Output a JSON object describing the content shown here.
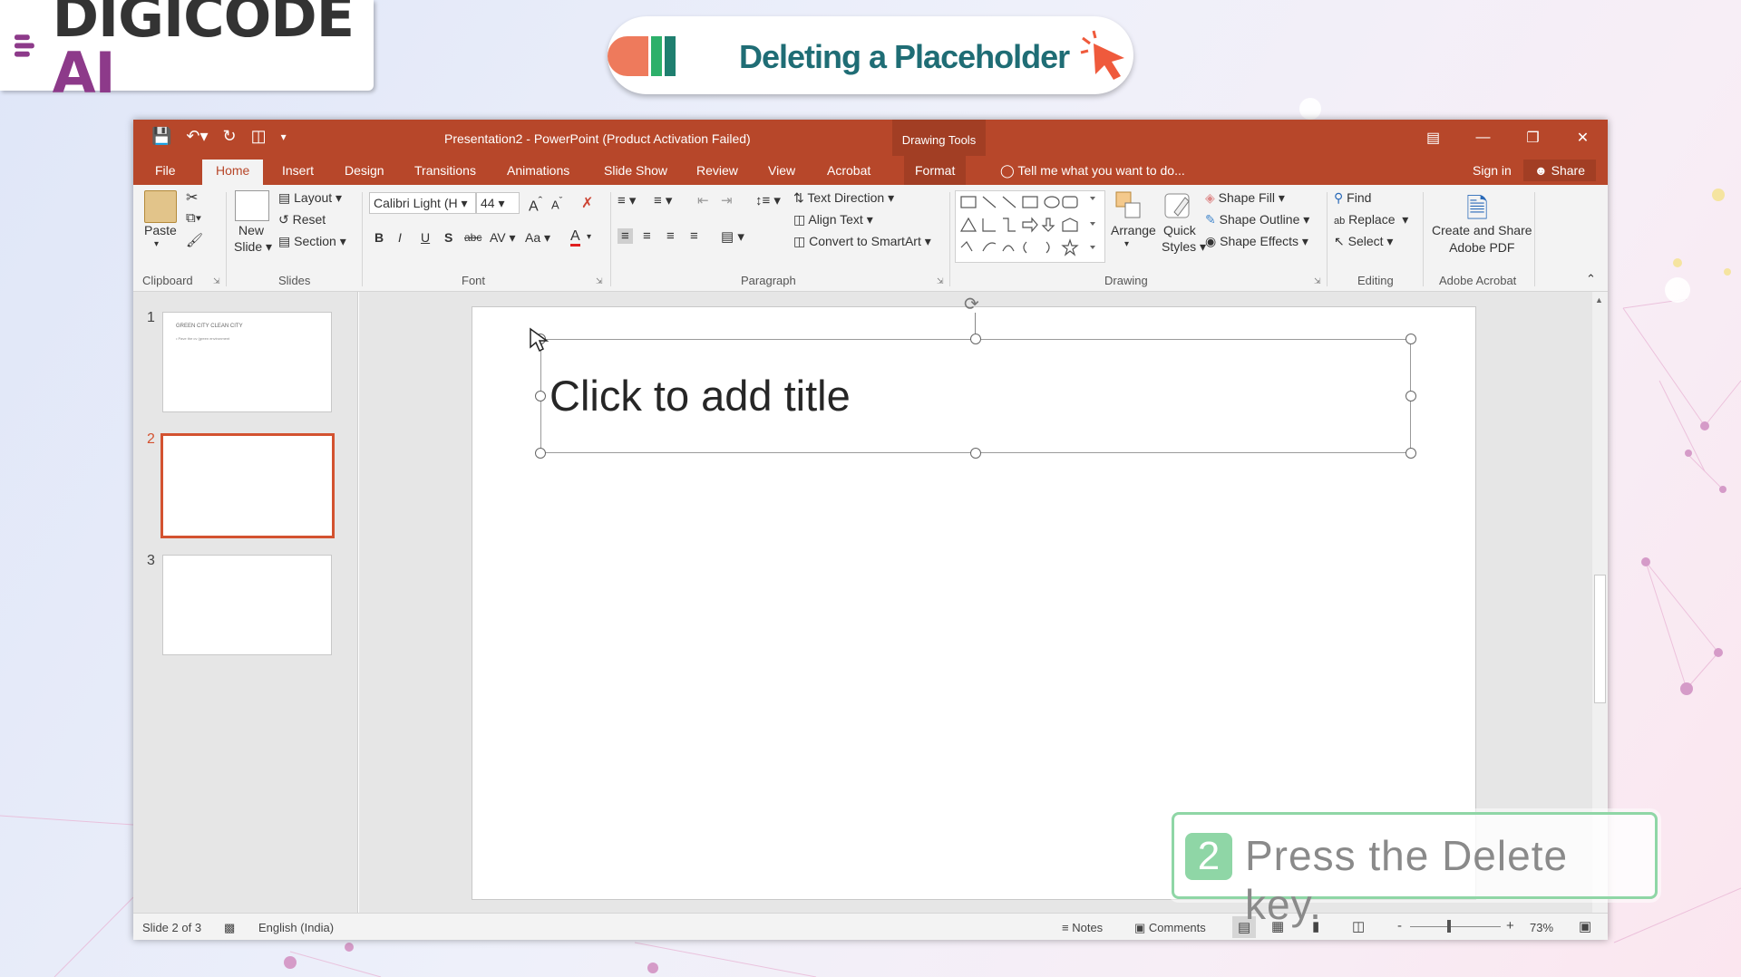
{
  "brand": {
    "logo_main": "DIGICODE",
    "logo_accent": "AI"
  },
  "lesson": {
    "title": "Deleting a Placeholder"
  },
  "window": {
    "title": "Presentation2 - PowerPoint (Product Activation Failed)",
    "contextual_tab_group": "Drawing Tools"
  },
  "tabs": [
    "File",
    "Home",
    "Insert",
    "Design",
    "Transitions",
    "Animations",
    "Slide Show",
    "Review",
    "View",
    "Acrobat",
    "Format"
  ],
  "tell_me": "Tell me what you want to do...",
  "account": {
    "sign_in": "Sign in",
    "share": "Share"
  },
  "ribbon": {
    "clipboard": {
      "label": "Clipboard",
      "paste": "Paste"
    },
    "slides": {
      "label": "Slides",
      "new_slide_1": "New",
      "new_slide_2": "Slide",
      "layout": "Layout",
      "reset": "Reset",
      "section": "Section"
    },
    "font": {
      "label": "Font",
      "font_name": "Calibri Light (H",
      "font_size": "44",
      "bold": "B",
      "italic": "I",
      "underline": "U",
      "shadow": "S",
      "strike": "abc",
      "spacing": "AV",
      "case": "Aa",
      "grow": "A",
      "shrink": "A",
      "color": "A"
    },
    "paragraph": {
      "label": "Paragraph",
      "text_direction": "Text Direction",
      "align_text": "Align Text",
      "convert_smartart": "Convert to SmartArt"
    },
    "drawing": {
      "label": "Drawing",
      "arrange": "Arrange",
      "quick_styles_1": "Quick",
      "quick_styles_2": "Styles",
      "shape_fill": "Shape Fill",
      "shape_outline": "Shape Outline",
      "shape_effects": "Shape Effects"
    },
    "editing": {
      "label": "Editing",
      "find": "Find",
      "replace": "Replace",
      "select": "Select"
    },
    "adobe": {
      "label": "Adobe Acrobat",
      "create_1": "Create and Share",
      "create_2": "Adobe PDF"
    }
  },
  "slides_panel": [
    {
      "num": "1",
      "title": "GREEN CITY CLEAN CITY",
      "bullet": "• Pave the cv (green environment"
    },
    {
      "num": "2",
      "title": "",
      "bullet": ""
    },
    {
      "num": "3",
      "title": "",
      "bullet": ""
    }
  ],
  "placeholder": {
    "text": "Click to add title"
  },
  "status": {
    "slide": "Slide 2 of 3",
    "language": "English (India)",
    "notes": "Notes",
    "comments": "Comments",
    "zoom": "73%",
    "zoom_minus": "-",
    "zoom_plus": "+"
  },
  "hint": {
    "step": "2",
    "text": "Press the Delete key."
  },
  "colors": {
    "accent": "#b7472a",
    "hint_green": "#8fd6a6",
    "title_teal": "#1f6d75",
    "logo_purple": "#8d3a8a"
  }
}
